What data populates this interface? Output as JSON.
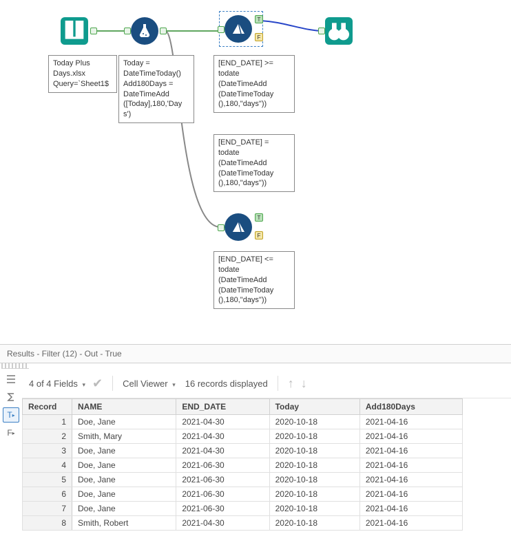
{
  "workflow": {
    "input_tool": {
      "anno": "Today Plus\nDays.xlsx\nQuery=`Sheet1$"
    },
    "formula_tool": {
      "anno": "Today =\nDateTimeToday()\nAdd180Days =\nDateTimeAdd\n([Today],180,'Day\ns')"
    },
    "filter1": {
      "anno": "[END_DATE] >=\ntodate\n(DateTimeAdd\n(DateTimeToday\n(),180,\"days\"))"
    },
    "filter2": {
      "anno": "[END_DATE] =\ntodate\n(DateTimeAdd\n(DateTimeToday\n(),180,\"days\"))"
    },
    "filter3": {
      "anno": "[END_DATE] <=\ntodate\n(DateTimeAdd\n(DateTimeToday\n(),180,\"days\"))"
    }
  },
  "results": {
    "title": "Results - Filter (12) - Out - True",
    "fields_label": "4 of 4 Fields",
    "cell_viewer": "Cell Viewer",
    "records_label": "16 records displayed",
    "rail_T": "T",
    "rail_F": "F",
    "columns": [
      "Record",
      "NAME",
      "END_DATE",
      "Today",
      "Add180Days"
    ],
    "rows": [
      {
        "rec": "1",
        "name": "Doe, Jane",
        "end": "2021-04-30",
        "today": "2020-10-18",
        "add": "2021-04-16"
      },
      {
        "rec": "2",
        "name": "Smith, Mary",
        "end": "2021-04-30",
        "today": "2020-10-18",
        "add": "2021-04-16"
      },
      {
        "rec": "3",
        "name": "Doe, Jane",
        "end": "2021-04-30",
        "today": "2020-10-18",
        "add": "2021-04-16"
      },
      {
        "rec": "4",
        "name": "Doe, Jane",
        "end": "2021-06-30",
        "today": "2020-10-18",
        "add": "2021-04-16"
      },
      {
        "rec": "5",
        "name": "Doe, Jane",
        "end": "2021-06-30",
        "today": "2020-10-18",
        "add": "2021-04-16"
      },
      {
        "rec": "6",
        "name": "Doe, Jane",
        "end": "2021-06-30",
        "today": "2020-10-18",
        "add": "2021-04-16"
      },
      {
        "rec": "7",
        "name": "Doe, Jane",
        "end": "2021-06-30",
        "today": "2020-10-18",
        "add": "2021-04-16"
      },
      {
        "rec": "8",
        "name": "Smith, Robert",
        "end": "2021-04-30",
        "today": "2020-10-18",
        "add": "2021-04-16"
      }
    ]
  }
}
